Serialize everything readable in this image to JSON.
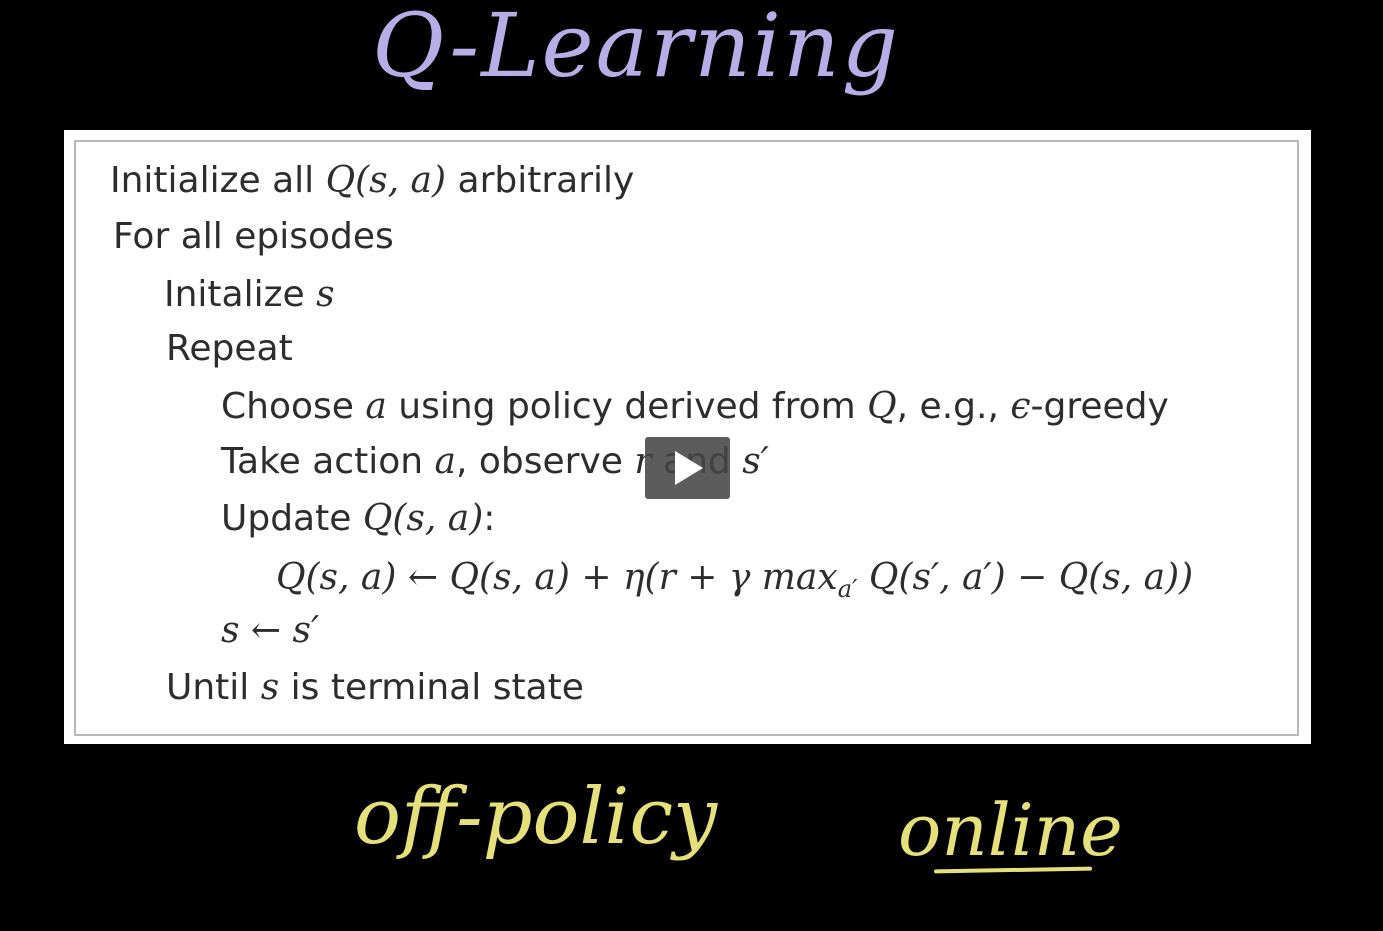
{
  "slide": {
    "title": "Q-Learning",
    "algorithm": {
      "line1_a": "Initialize all ",
      "line1_math": "Q(s, a)",
      "line1_b": " arbitrarily",
      "line2": "For all episodes",
      "line3_a": "Initalize ",
      "line3_math": "s",
      "line4": "Repeat",
      "line5_a": "Choose ",
      "line5_m1": "a",
      "line5_b": " using policy derived from ",
      "line5_m2": "Q",
      "line5_c": ", e.g., ",
      "line5_m3": "ϵ",
      "line5_d": "-greedy",
      "line6_a": "Take action ",
      "line6_m1": "a",
      "line6_b": ", observe ",
      "line6_m2": "r",
      "line6_c": " and ",
      "line6_m3": "s′",
      "line7_a": "Update ",
      "line7_math": "Q(s, a)",
      "line7_b": ":",
      "line8": "Q(s, a) ← Q(s, a) + η(r + γ max",
      "line8_sub": "a′",
      "line8_b": " Q(s′, a′) − Q(s, a))",
      "line9": "s ← s′",
      "line10_a": "Until ",
      "line10_math": "s",
      "line10_b": " is terminal state"
    },
    "annotations": {
      "off_policy": "off-policy",
      "online": "online"
    }
  },
  "player": {
    "play_icon": "play-icon"
  },
  "colors": {
    "background": "#000000",
    "title_ink": "#b7aee8",
    "annotation_ink": "#e6e07a",
    "box_bg": "#ffffff",
    "text": "#2d2d2d"
  }
}
